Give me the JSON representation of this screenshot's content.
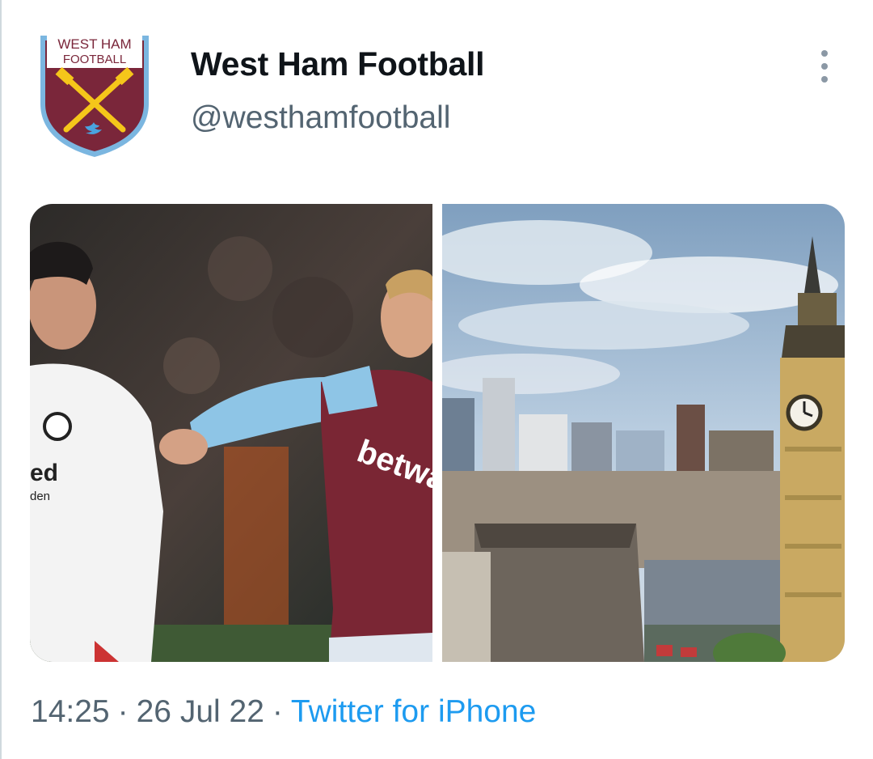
{
  "tweet": {
    "author": {
      "display_name": "West Ham Football",
      "handle": "@westhamfootball",
      "avatar": {
        "icon": "west-ham-crest-icon",
        "text_line1": "WEST HAM",
        "text_line2": "FOOTBALL"
      }
    },
    "more_icon": "more-options-icon",
    "media": [
      {
        "name": "football-match-photo",
        "shirt_text": "betway"
      },
      {
        "name": "london-skyline-photo"
      }
    ],
    "time": "14:25",
    "date": "26 Jul 22",
    "separator": "·",
    "source": "Twitter for iPhone"
  },
  "colors": {
    "claret": "#7a263a",
    "sky_blue": "#7bb6e0",
    "gold": "#f5c61a",
    "link": "#1d9bf0",
    "secondary_text": "#536471"
  }
}
